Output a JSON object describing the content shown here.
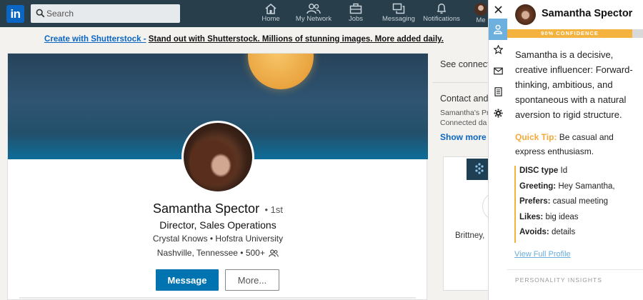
{
  "nav": {
    "logo": "in",
    "search_placeholder": "Search",
    "items": [
      {
        "label": "Home",
        "icon": "home-icon"
      },
      {
        "label": "My Network",
        "icon": "network-icon"
      },
      {
        "label": "Jobs",
        "icon": "briefcase-icon"
      },
      {
        "label": "Messaging",
        "icon": "messaging-icon"
      },
      {
        "label": "Notifications",
        "icon": "bell-icon"
      },
      {
        "label": "Me",
        "icon": "avatar"
      }
    ]
  },
  "banner": {
    "link_text": "Create with Shutterstock -",
    "message": "Stand out with Shutterstock. Millions of stunning images. More added daily."
  },
  "profile": {
    "name": "Samantha Spector",
    "degree": "• 1st",
    "headline": "Director, Sales Operations",
    "education": "Crystal Knows • Hofstra University",
    "location": "Nashville, Tennessee • 500+",
    "message_button": "Message",
    "more_button": "More..."
  },
  "right_column": {
    "see_connections": "See connect",
    "contact_title": "Contact and",
    "contact_line1": "Samantha's Pr",
    "contact_line2": "Connected da",
    "show_more": "Show more",
    "ad_name": "Brittney,"
  },
  "crystal": {
    "name": "Samantha Spector",
    "confidence_label": "90% CONFIDENCE",
    "confidence": 0.92,
    "summary": "Samantha is a decisive, creative influencer: Forward-thinking, ambitious, and spontaneous with a natural aversion to rigid structure.",
    "quick_tip_label": "Quick Tip:",
    "quick_tip_text": "Be casual and express enthusiasm.",
    "disc": [
      {
        "label": "DISC type",
        "value": "Id"
      },
      {
        "label": "Greeting:",
        "value": "Hey Samantha,"
      },
      {
        "label": "Prefers:",
        "value": "casual meeting"
      },
      {
        "label": "Likes:",
        "value": "big ideas"
      },
      {
        "label": "Avoids:",
        "value": "details"
      }
    ],
    "view_full_profile": "View Full Profile",
    "insights_header": "PERSONALITY INSIGHTS"
  },
  "colors": {
    "nav_bg": "#283e4a",
    "linkedin_blue": "#0073b1",
    "crystal_accent": "#f4b23f",
    "crystal_rail_active": "#6db0dd"
  }
}
